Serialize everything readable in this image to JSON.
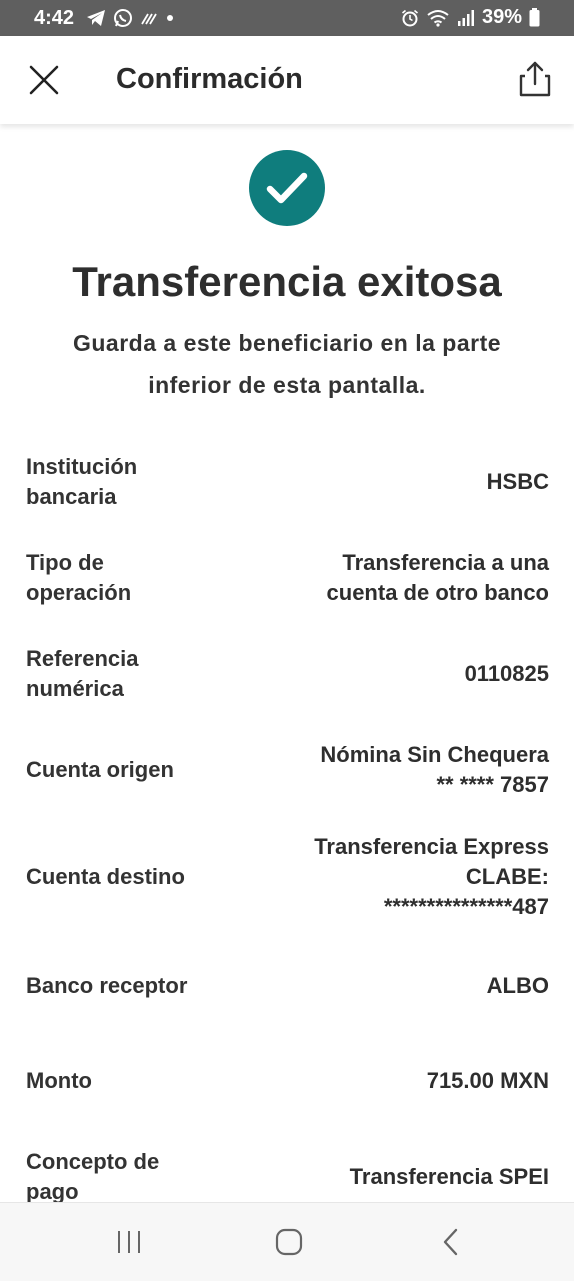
{
  "status_bar": {
    "time": "4:42",
    "battery": "39%",
    "icons_left": [
      "telegram-icon",
      "whatsapp-icon",
      "signal-wave-icon",
      "dot-icon"
    ],
    "icons_right": [
      "alarm-icon",
      "wifi-icon",
      "cell-signal-icon",
      "battery-icon"
    ]
  },
  "header": {
    "title": "Confirmación",
    "left_icon": "close-icon",
    "right_icon": "share-icon"
  },
  "success": {
    "icon": "check-circle-icon",
    "accent_color": "#0f7d7d",
    "title": "Transferencia exitosa",
    "subtitle_line1": "Guarda a este beneficiario en la parte",
    "subtitle_line2": "inferior de esta pantalla."
  },
  "details": [
    {
      "label_lines": [
        "Institución",
        "bancaria"
      ],
      "value_lines": [
        "HSBC"
      ]
    },
    {
      "label_lines": [
        "Tipo de",
        "operación"
      ],
      "value_lines": [
        "Transferencia a una",
        "cuenta de otro banco"
      ]
    },
    {
      "label_lines": [
        "Referencia",
        "numérica"
      ],
      "value_lines": [
        "0110825"
      ]
    },
    {
      "label_lines": [
        "Cuenta origen"
      ],
      "value_lines": [
        "Nómina Sin Chequera",
        "** **** 7857"
      ]
    },
    {
      "label_lines": [
        "Cuenta destino"
      ],
      "value_lines": [
        "Transferencia Express",
        "CLABE:",
        "***************487"
      ]
    },
    {
      "label_lines": [
        "Banco receptor"
      ],
      "value_lines": [
        "ALBO"
      ]
    },
    {
      "label_lines": [
        "Monto"
      ],
      "value_lines": [
        "715.00 MXN"
      ]
    },
    {
      "label_lines": [
        "Concepto de",
        "pago"
      ],
      "value_lines": [
        "Transferencia SPEI"
      ]
    }
  ],
  "nav_bar": {
    "icons": [
      "recent-apps-icon",
      "home-icon",
      "back-icon"
    ]
  }
}
